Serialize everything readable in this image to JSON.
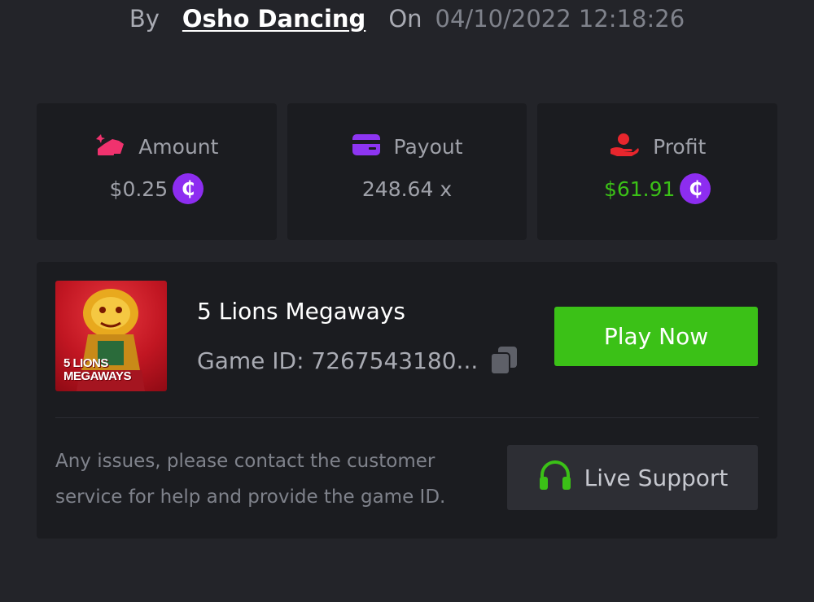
{
  "byline": {
    "by_label": "By",
    "author": "Osho Dancing",
    "on_label": "On",
    "datetime": "04/10/2022 12:18:26"
  },
  "stats": {
    "amount": {
      "label": "Amount",
      "value": "$0.25",
      "icon": "amount-icon",
      "currency_icon": "coin-icon"
    },
    "payout": {
      "label": "Payout",
      "value": "248.64 x",
      "icon": "wallet-card-icon"
    },
    "profit": {
      "label": "Profit",
      "value": "$61.91",
      "icon": "hand-profit-icon",
      "currency_icon": "coin-icon"
    }
  },
  "game": {
    "thumbnail_title_line1": "5 LIONS",
    "thumbnail_title_line2": "MEGAWAYS",
    "name": "5 Lions Megaways",
    "id_text": "Game ID: 7267543180...",
    "play_label": "Play Now"
  },
  "support": {
    "help_text": "Any issues, please contact the customer service for help and provide the game ID.",
    "button_label": "Live Support",
    "icon": "headset-icon"
  },
  "colors": {
    "background": "#232429",
    "card": "#1b1c20",
    "accent_green": "#3bc117",
    "coin_purple": "#8d2df0",
    "amount_pink": "#f0326e",
    "payout_purple": "#8d35f2",
    "profit_red": "#e8262d"
  }
}
